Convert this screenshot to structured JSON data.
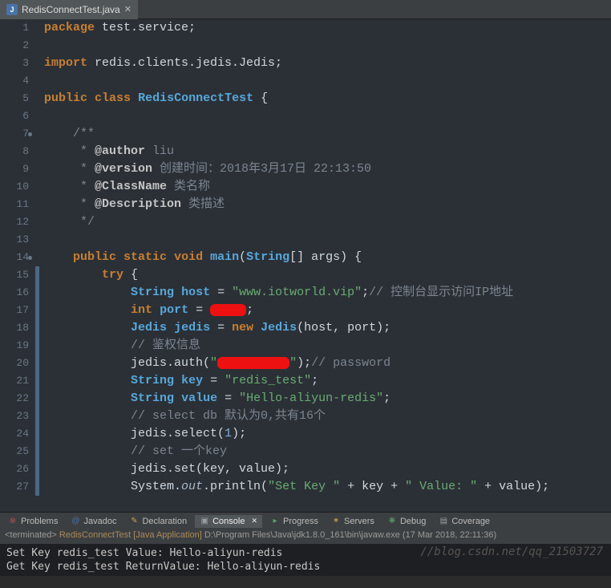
{
  "tab": {
    "filename": "RedisConnectTest.java",
    "icon": "J"
  },
  "gutter": {
    "markers": [
      7,
      14
    ]
  },
  "code_lines": [
    [
      [
        "kw",
        "package"
      ],
      [
        "plain",
        " test.service;"
      ]
    ],
    [],
    [
      [
        "kw",
        "import"
      ],
      [
        "plain",
        " redis.clients.jedis.Jedis;"
      ]
    ],
    [],
    [
      [
        "kw",
        "public"
      ],
      [
        "plain",
        " "
      ],
      [
        "kw",
        "class"
      ],
      [
        "plain",
        " "
      ],
      [
        "cls",
        "RedisConnectTest"
      ],
      [
        "plain",
        " {"
      ]
    ],
    [],
    [
      [
        "doc",
        "    /**"
      ]
    ],
    [
      [
        "doc",
        "     * "
      ],
      [
        "doctag",
        "@author"
      ],
      [
        "doc",
        " liu"
      ]
    ],
    [
      [
        "doc",
        "     * "
      ],
      [
        "doctag",
        "@version"
      ],
      [
        "doc",
        " 创建时间：2018年3月17日 22:13:50"
      ]
    ],
    [
      [
        "doc",
        "     * "
      ],
      [
        "doctag",
        "@ClassName"
      ],
      [
        "doc",
        " 类名称"
      ]
    ],
    [
      [
        "doc",
        "     * "
      ],
      [
        "doctag",
        "@Description"
      ],
      [
        "doc",
        " 类描述"
      ]
    ],
    [
      [
        "doc",
        "     */"
      ]
    ],
    [],
    [
      [
        "plain",
        "    "
      ],
      [
        "kw",
        "public"
      ],
      [
        "plain",
        " "
      ],
      [
        "kw",
        "static"
      ],
      [
        "plain",
        " "
      ],
      [
        "kw",
        "void"
      ],
      [
        "plain",
        " "
      ],
      [
        "method",
        "main"
      ],
      [
        "plain",
        "("
      ],
      [
        "cls",
        "String"
      ],
      [
        "plain",
        "[] args) {"
      ]
    ],
    [
      [
        "plain",
        "        "
      ],
      [
        "kw",
        "try"
      ],
      [
        "plain",
        " {"
      ]
    ],
    [
      [
        "plain",
        "            "
      ],
      [
        "cls",
        "String"
      ],
      [
        "plain",
        " "
      ],
      [
        "cls",
        "host"
      ],
      [
        "plain",
        " = "
      ],
      [
        "str",
        "\"www.iotworld.vip\""
      ],
      [
        "plain",
        ";"
      ],
      [
        "cmt",
        "// 控制台显示访问IP地址"
      ]
    ],
    [
      [
        "plain",
        "            "
      ],
      [
        "kw",
        "int"
      ],
      [
        "plain",
        " "
      ],
      [
        "cls",
        "port"
      ],
      [
        "plain",
        " = "
      ],
      [
        "redact",
        "     "
      ],
      [
        "plain",
        ";"
      ]
    ],
    [
      [
        "plain",
        "            "
      ],
      [
        "cls",
        "Jedis"
      ],
      [
        "plain",
        " "
      ],
      [
        "cls",
        "jedis"
      ],
      [
        "plain",
        " = "
      ],
      [
        "kw",
        "new"
      ],
      [
        "plain",
        " "
      ],
      [
        "cls",
        "Jedis"
      ],
      [
        "plain",
        "(host, port);"
      ]
    ],
    [
      [
        "plain",
        "            "
      ],
      [
        "cmt",
        "// 鉴权信息"
      ]
    ],
    [
      [
        "plain",
        "            jedis.auth("
      ],
      [
        "str",
        "\""
      ],
      [
        "redact",
        "          "
      ],
      [
        "str",
        "\""
      ],
      [
        "plain",
        ");"
      ],
      [
        "cmt",
        "// password"
      ]
    ],
    [
      [
        "plain",
        "            "
      ],
      [
        "cls",
        "String"
      ],
      [
        "plain",
        " "
      ],
      [
        "cls",
        "key"
      ],
      [
        "plain",
        " = "
      ],
      [
        "str",
        "\"redis_test\""
      ],
      [
        "plain",
        ";"
      ]
    ],
    [
      [
        "plain",
        "            "
      ],
      [
        "cls",
        "String"
      ],
      [
        "plain",
        " "
      ],
      [
        "cls",
        "value"
      ],
      [
        "plain",
        " = "
      ],
      [
        "str",
        "\"Hello-aliyun-redis\""
      ],
      [
        "plain",
        ";"
      ]
    ],
    [
      [
        "plain",
        "            "
      ],
      [
        "cmt",
        "// select db 默认为0,共有16个"
      ]
    ],
    [
      [
        "plain",
        "            jedis.select("
      ],
      [
        "num",
        "1"
      ],
      [
        "plain",
        ");"
      ]
    ],
    [
      [
        "plain",
        "            "
      ],
      [
        "cmt",
        "// set 一个key"
      ]
    ],
    [
      [
        "plain",
        "            jedis.set(key, value);"
      ]
    ],
    [
      [
        "plain",
        "            System."
      ],
      [
        "italic",
        "out"
      ],
      [
        "plain",
        ".println("
      ],
      [
        "str",
        "\"Set Key \""
      ],
      [
        "plain",
        " + key + "
      ],
      [
        "str",
        "\" Value: \""
      ],
      [
        "plain",
        " + value);"
      ]
    ]
  ],
  "bottom_tabs": [
    {
      "icon": "⊗",
      "label": "Problems",
      "color": "#b05050"
    },
    {
      "icon": "@",
      "label": "Javadoc",
      "color": "#4a72a5"
    },
    {
      "icon": "✎",
      "label": "Declaration",
      "color": "#c7a34a"
    },
    {
      "icon": "▣",
      "label": "Console",
      "color": "#9aa0a6",
      "active": true
    },
    {
      "icon": "▸",
      "label": "Progress",
      "color": "#5aa56a"
    },
    {
      "icon": "✶",
      "label": "Servers",
      "color": "#c7a34a"
    },
    {
      "icon": "❋",
      "label": "Debug",
      "color": "#5aa56a"
    },
    {
      "icon": "▤",
      "label": "Coverage",
      "color": "#9aa0a6"
    }
  ],
  "console_header": {
    "terminated": "<terminated>",
    "app": "RedisConnectTest [Java Application]",
    "path": "D:\\Program Files\\Java\\jdk1.8.0_161\\bin\\javaw.exe",
    "time": "(17 Mar 2018, 22:11:36)"
  },
  "console_output": [
    "Set Key redis_test Value: Hello-aliyun-redis",
    "Get Key redis_test ReturnValue: Hello-aliyun-redis"
  ],
  "watermark": "//blog.csdn.net/qq_21503727"
}
